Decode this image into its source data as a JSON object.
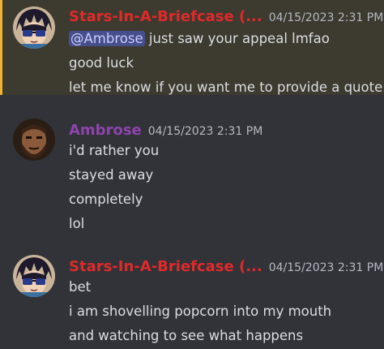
{
  "colors": {
    "background": "#313338",
    "mention_bg": "#3d3a30",
    "mention_bar": "#f0b232",
    "stars_name": "#e02a2a",
    "ambrose_name": "#8e44ad",
    "text": "#dbdee1",
    "timestamp": "#b5bac1",
    "mention_pill_bg": "#464f8c",
    "mention_pill_text": "#c9cdfb"
  },
  "messages": [
    {
      "author": "Stars-In-A-Briefcase (...",
      "timestamp": "04/15/2023 2:31 PM",
      "avatar_icon": "anime-sunglasses-avatar-icon",
      "mentions_me": true,
      "lines": [
        {
          "mention": "@Ambrose",
          "text": " just saw your appeal lmfao"
        },
        {
          "text": "good luck"
        },
        {
          "text": "let me know if you want me to provide a quote"
        }
      ]
    },
    {
      "author": "Ambrose",
      "timestamp": "04/15/2023 2:31 PM",
      "avatar_icon": "bearded-man-avatar-icon",
      "mentions_me": false,
      "lines": [
        {
          "text": "i'd rather you"
        },
        {
          "text": "stayed away"
        },
        {
          "text": "completely"
        },
        {
          "text": "lol"
        }
      ]
    },
    {
      "author": "Stars-In-A-Briefcase (...",
      "timestamp": "04/15/2023 2:31 PM",
      "avatar_icon": "anime-sunglasses-avatar-icon",
      "mentions_me": false,
      "lines": [
        {
          "text": "bet"
        },
        {
          "text": "i am shovelling popcorn into my mouth"
        },
        {
          "text": "and watching to see what happens"
        }
      ]
    }
  ]
}
